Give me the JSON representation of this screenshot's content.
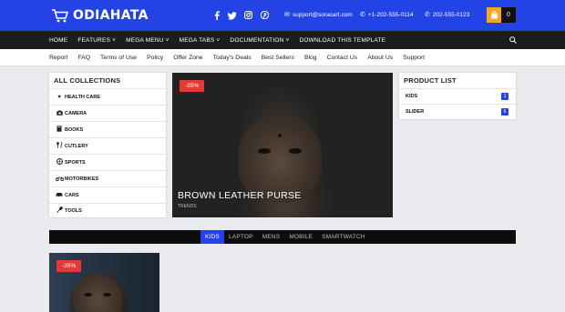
{
  "brand": {
    "name": "ODIAHATA"
  },
  "header": {
    "social_icons": [
      "facebook-icon",
      "twitter-icon",
      "instagram-icon",
      "pinterest-icon"
    ],
    "email": "support@soracart.com",
    "phone": "+1-202-555-0114",
    "whatsapp": "202-555-0123",
    "cart_count": "0"
  },
  "main_nav": {
    "items": [
      "HOME",
      "FEATURES ˅",
      "MEGA MENU ˅",
      "MEGA TABS ˅",
      "DOCUMENTATION ˅",
      "DOWNLOAD THIS TEMPLATE"
    ]
  },
  "sub_nav": {
    "items": [
      "Report",
      "FAQ",
      "Terms of Use",
      "Policy",
      "Offer Zone",
      "Today's Deals",
      "Best Sellers",
      "Blog",
      "Contact Us",
      "About Us",
      "Support"
    ]
  },
  "collections": {
    "title": "ALL COLLECTIONS",
    "items": [
      {
        "label": "HEALTH CARE",
        "icon": "heart-icon"
      },
      {
        "label": "CAMERA",
        "icon": "camera-icon"
      },
      {
        "label": "BOOKS",
        "icon": "book-icon"
      },
      {
        "label": "CUTLERY",
        "icon": "cutlery-icon"
      },
      {
        "label": "SPORTS",
        "icon": "sports-icon"
      },
      {
        "label": "MOTORBIKES",
        "icon": "motorbike-icon"
      },
      {
        "label": "CARS",
        "icon": "car-icon"
      },
      {
        "label": "TOOLS",
        "icon": "wrench-icon"
      }
    ]
  },
  "hero": {
    "badge": "-35%",
    "title": "BROWN LEATHER PURSE",
    "meta": "TRENDS"
  },
  "product_list": {
    "title": "PRODUCT LIST",
    "items": [
      {
        "label": "KIDS",
        "count": "1"
      },
      {
        "label": "SLIDER",
        "count": "6"
      }
    ]
  },
  "product_tabs": {
    "items": [
      "KIDS",
      "LAPTOP",
      "MENS",
      "MOBILE",
      "SMARTWATCH"
    ],
    "active": "KIDS"
  },
  "card": {
    "badge": "-35%"
  },
  "colors": {
    "primary": "#2443e6",
    "nav_dark": "#1c1c1c",
    "badge_red": "#e53935",
    "cart_orange": "#f5a623"
  }
}
